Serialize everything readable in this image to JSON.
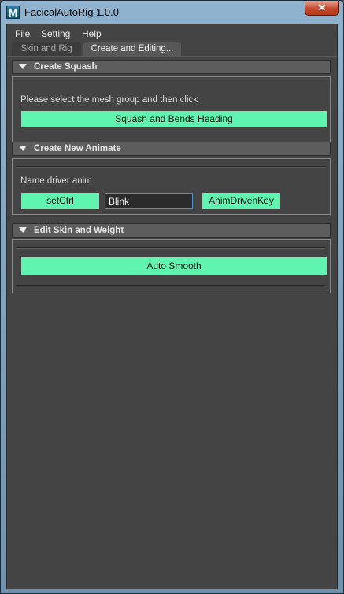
{
  "window": {
    "title": "FacicalAutoRig 1.0.0",
    "close_glyph": "✕",
    "app_icon": "M"
  },
  "menu": [
    "File",
    "Setting",
    "Help"
  ],
  "tabs": [
    {
      "label": "Skin and Rig",
      "active": false
    },
    {
      "label": "Create and Editing...",
      "active": true
    }
  ],
  "sections": {
    "squash": {
      "title": "Create Squash",
      "instruction": "Please select the mesh group and then click",
      "button": "Squash and Bends Heading"
    },
    "animate": {
      "title": "Create New Animate",
      "label": "Name driver anim",
      "set_ctrl": "setCtrl",
      "input_value": "Blink",
      "anim_key": "AnimDrivenKey"
    },
    "skin": {
      "title": "Edit Skin and Weight",
      "auto_smooth": "Auto Smooth"
    }
  },
  "colors": {
    "accent_button": "#5ff4b0",
    "panel_bg": "#444444",
    "input_focus": "#5b8fc7"
  }
}
